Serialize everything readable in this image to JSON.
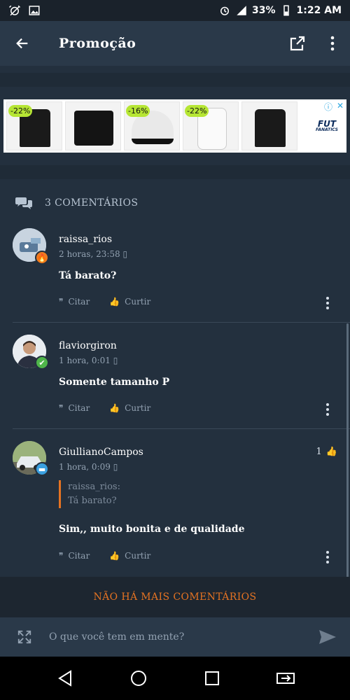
{
  "statusbar": {
    "battery": "33%",
    "time": "1:22 AM",
    "network": "4G"
  },
  "appbar": {
    "title": "Promoção"
  },
  "ad": {
    "badges": [
      "-22%",
      "-16%",
      "-22%"
    ],
    "logo_main": "FUT",
    "logo_sub": "FANATICS"
  },
  "comments": {
    "count_label": "3 COMENTÁRIOS",
    "items": [
      {
        "user": "raissa_rios",
        "meta": "2 horas, 23:58",
        "text": "Tá barato?",
        "cite": "Citar",
        "like": "Curtir"
      },
      {
        "user": "flaviorgiron",
        "meta": "1 hora, 0:01",
        "text": "Somente tamanho P",
        "cite": "Citar",
        "like": "Curtir"
      },
      {
        "user": "GiullianoCampos",
        "meta": "1 hora, 0:09",
        "likes": "1",
        "quote_user": "raissa_rios:",
        "quote_text": "Tá barato?",
        "text": "Sim,, muito bonita e de qualidade",
        "cite": "Citar",
        "like": "Curtir"
      }
    ]
  },
  "footer": {
    "no_more": "NÃO HÁ MAIS COMENTÁRIOS"
  },
  "input": {
    "placeholder": "O que você tem em mente?"
  },
  "colors": {
    "accent": "#e57322",
    "background": "#23303e",
    "bar": "#2a3949"
  }
}
